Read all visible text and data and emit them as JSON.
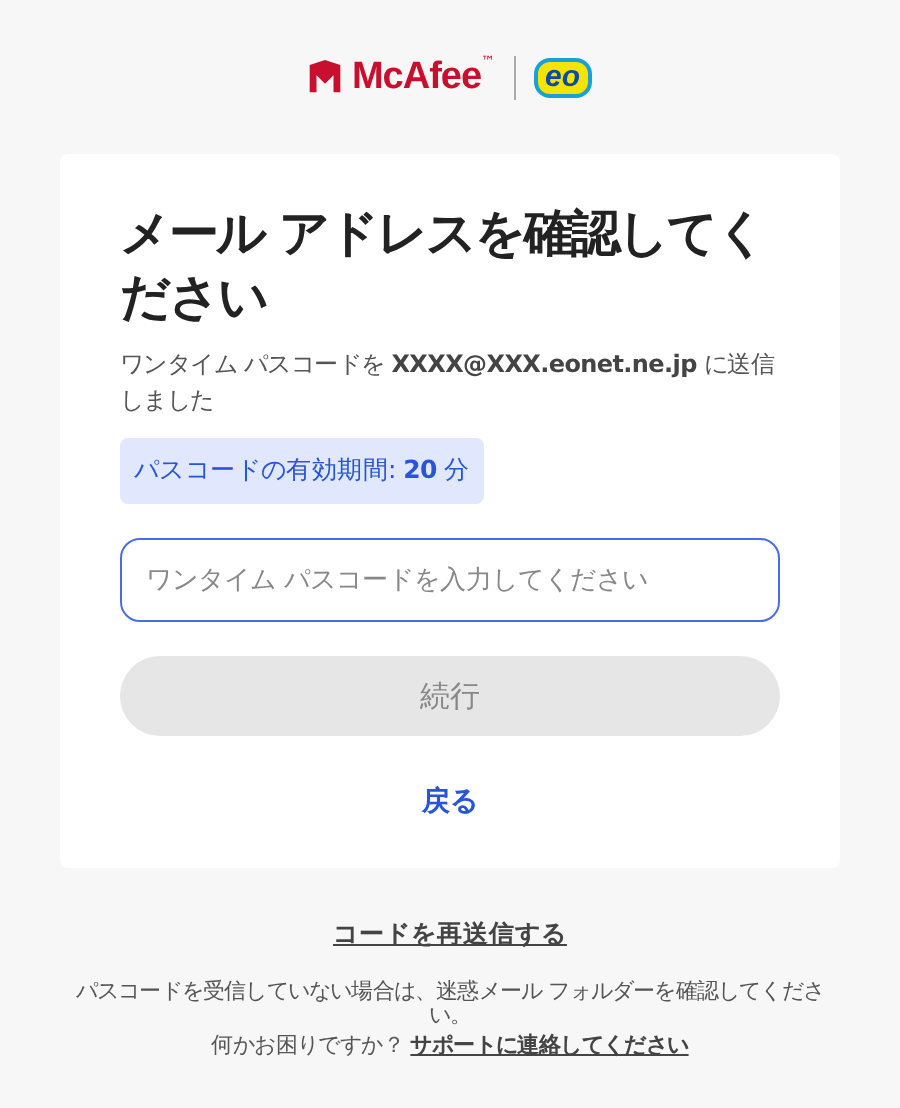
{
  "header": {
    "brand": "McAfee",
    "trademark": "™",
    "partner": "eo"
  },
  "card": {
    "title": "メール アドレスを確認してください",
    "message": "ワンタイム パスコードを **XXXX@XXX.eonet.ne.jp** に送信しました",
    "validity": "パスコードの有効期間: **20** 分",
    "passcode_field": {
      "placeholder": "ワンタイム パスコードを入力してください"
    },
    "continue_button": {
      "label": "続行",
      "disabled": true
    },
    "back_link": "戻る"
  },
  "footer": {
    "resend_link": "コードを再送信する",
    "spam_note": "パスコードを受信していない場合は、迷惑メール フォルダーを確認してください。",
    "help_prompt": "何かお困りですか？",
    "support_link": "サポートに連絡してください"
  }
}
